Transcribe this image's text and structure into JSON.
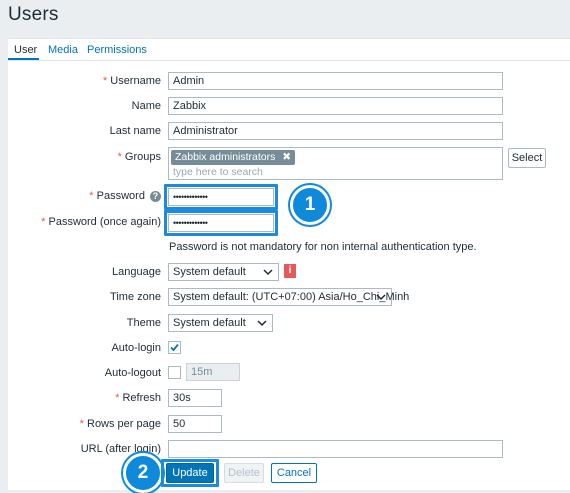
{
  "page": {
    "title": "Users"
  },
  "tabs": [
    {
      "label": "User"
    },
    {
      "label": "Media"
    },
    {
      "label": "Permissions"
    }
  ],
  "form": {
    "username": {
      "label": "Username",
      "value": "Admin"
    },
    "name": {
      "label": "Name",
      "value": "Zabbix"
    },
    "last_name": {
      "label": "Last name",
      "value": "Administrator"
    },
    "groups": {
      "label": "Groups",
      "tag": "Zabbix administrators",
      "placeholder": "type here to search",
      "select_label": "Select"
    },
    "password": {
      "label": "Password",
      "value": "•••••••••••••"
    },
    "password_again": {
      "label": "Password (once again)",
      "value": "•••••••••••••"
    },
    "password_hint": "Password is not mandatory for non internal authentication type.",
    "language": {
      "label": "Language",
      "value": "System default"
    },
    "timezone": {
      "label": "Time zone",
      "value": "System default: (UTC+07:00) Asia/Ho_Chi_Minh"
    },
    "theme": {
      "label": "Theme",
      "value": "System default"
    },
    "autologin": {
      "label": "Auto-login",
      "checked": true
    },
    "autologout": {
      "label": "Auto-logout",
      "value": "15m",
      "checked": false
    },
    "refresh": {
      "label": "Refresh",
      "value": "30s"
    },
    "rows_per_page": {
      "label": "Rows per page",
      "value": "50"
    },
    "url": {
      "label": "URL (after login)",
      "value": ""
    }
  },
  "buttons": {
    "update": "Update",
    "delete": "Delete",
    "cancel": "Cancel"
  },
  "callouts": {
    "one": "1",
    "two": "2"
  },
  "colors": {
    "accent": "#0275b8",
    "highlight": "#1a8ce0",
    "required": "#e45959",
    "warning": "#e45959"
  }
}
